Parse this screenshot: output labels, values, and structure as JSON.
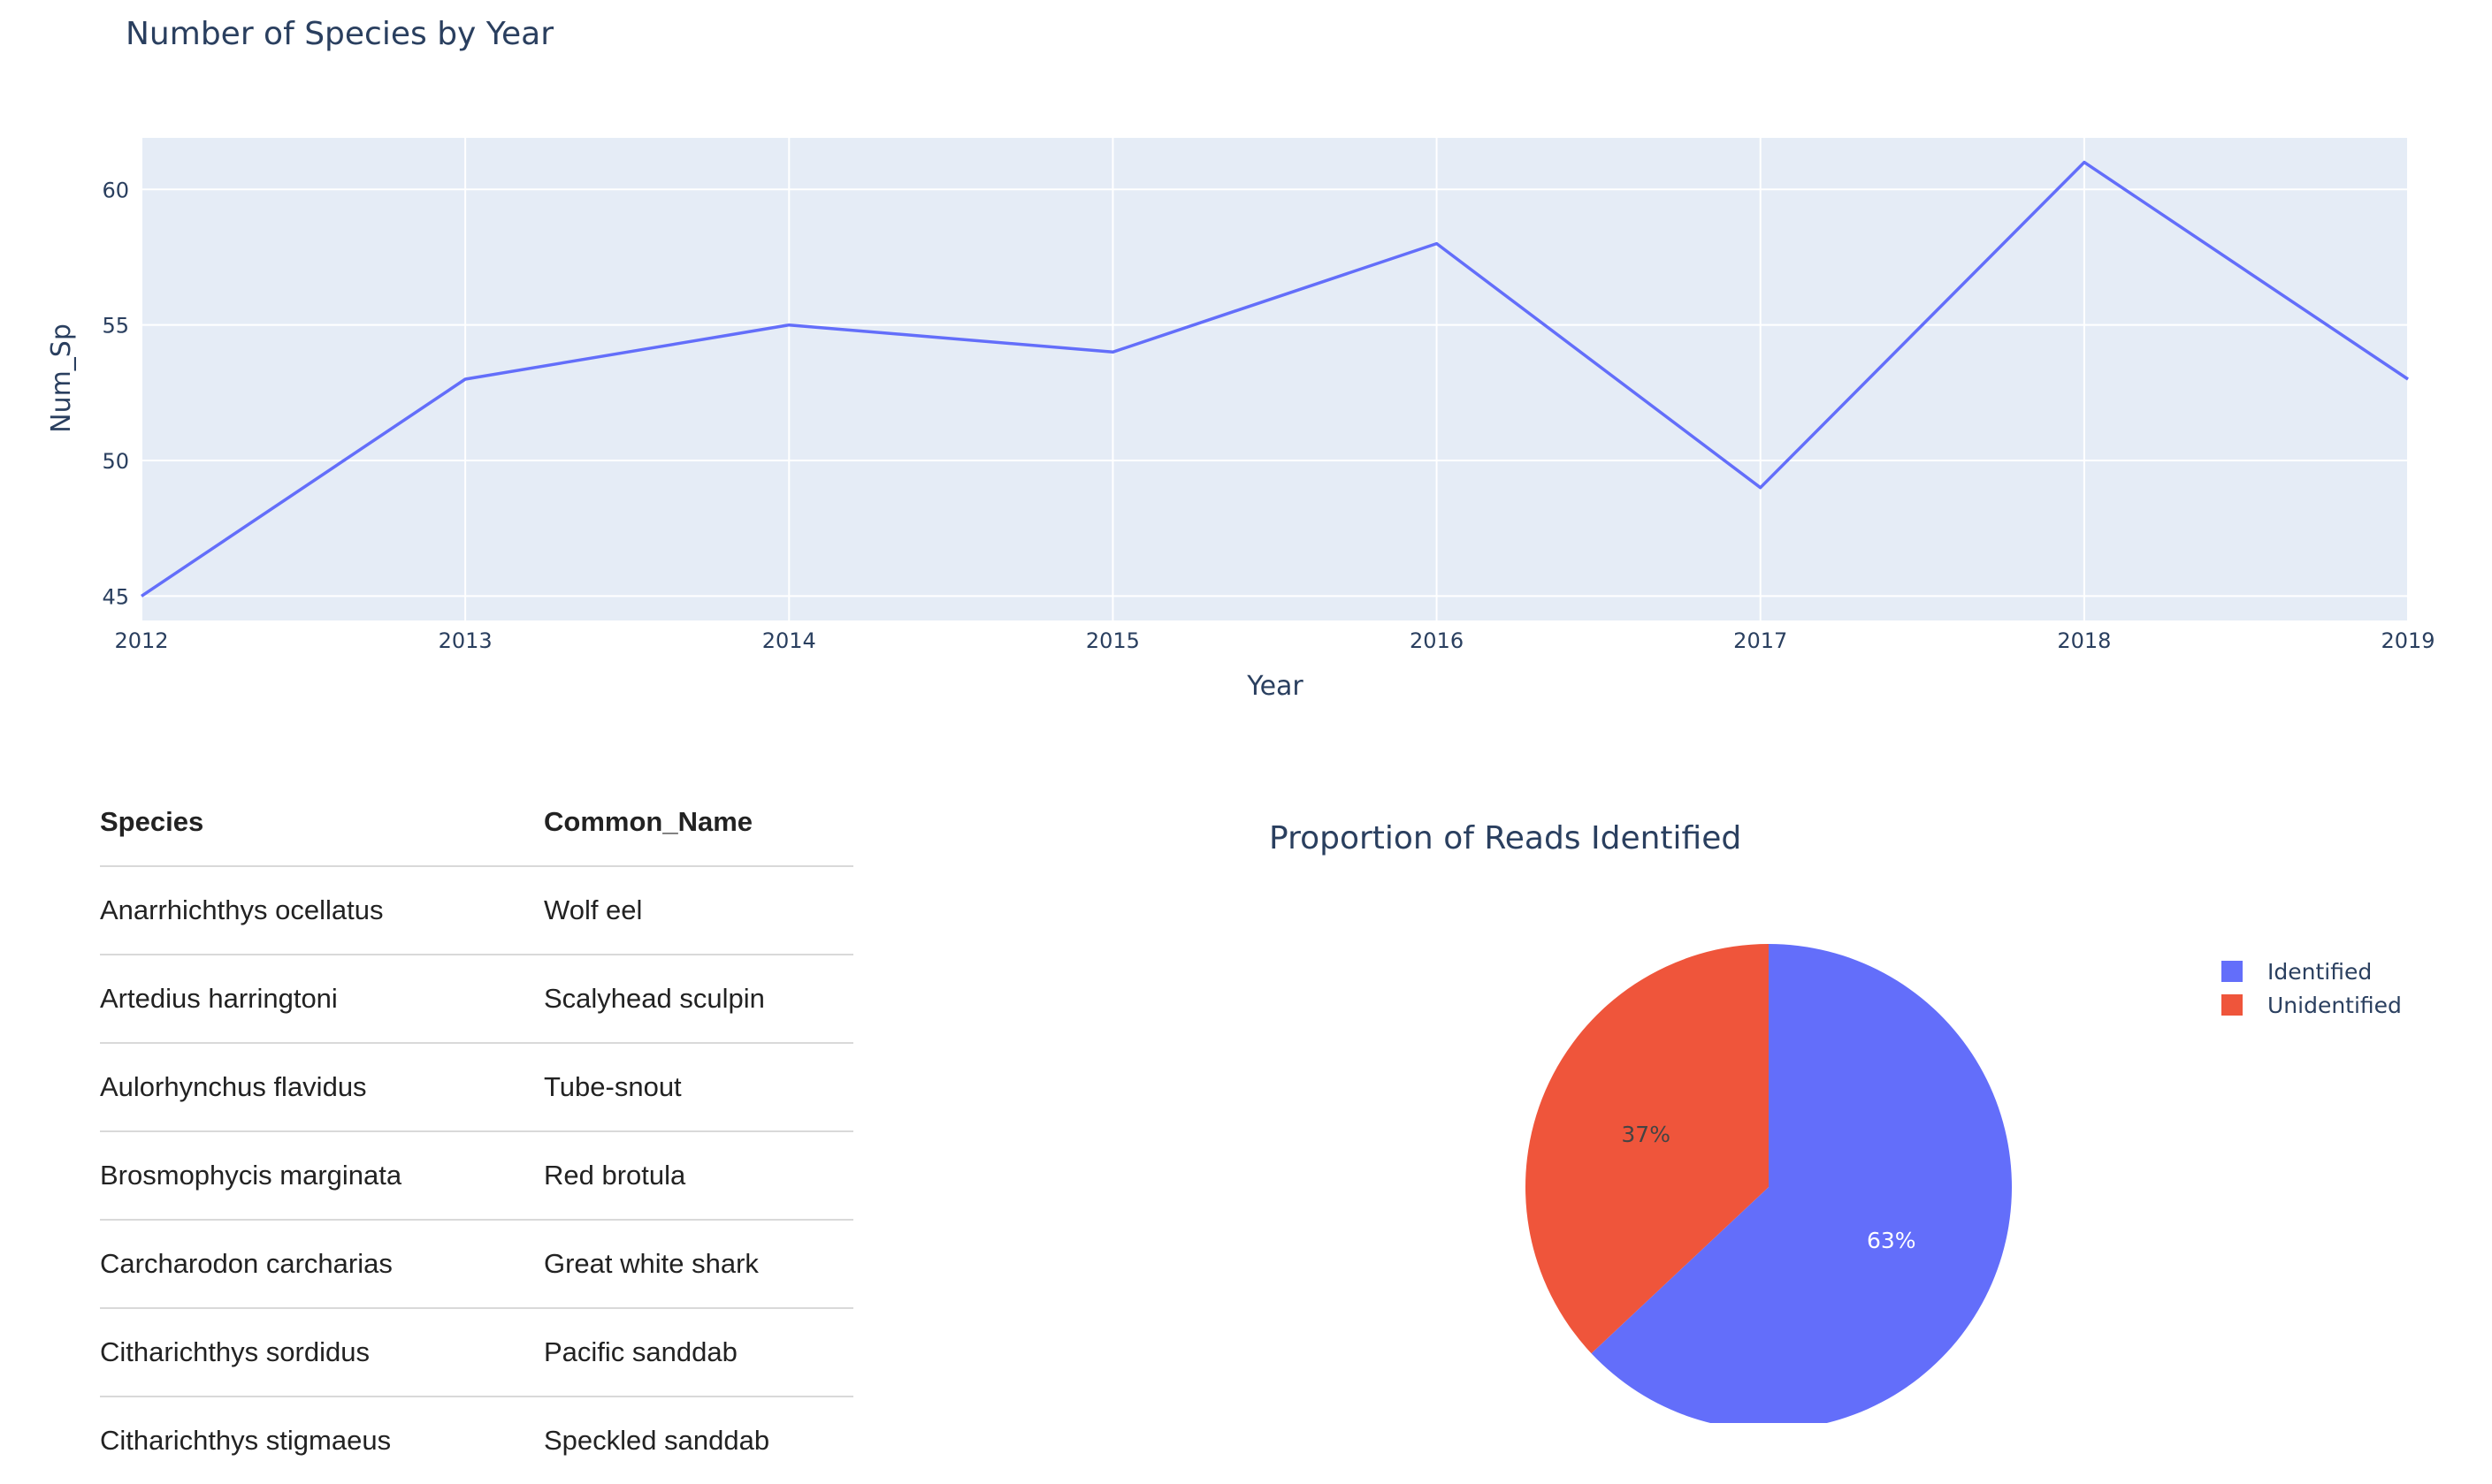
{
  "line_chart": {
    "title": "Number of Species by Year",
    "xlabel": "Year",
    "ylabel": "Num_Sp",
    "line_color": "#636efa",
    "plot_bg": "#e5ecf6"
  },
  "table": {
    "headers": [
      "Species",
      "Common_Name"
    ],
    "rows": [
      [
        "Anarrhichthys ocellatus",
        "Wolf eel"
      ],
      [
        "Artedius harringtoni",
        "Scalyhead sculpin"
      ],
      [
        "Aulorhynchus flavidus",
        "Tube-snout"
      ],
      [
        "Brosmophycis marginata",
        "Red brotula"
      ],
      [
        "Carcharodon carcharias",
        "Great white shark"
      ],
      [
        "Citharichthys sordidus",
        "Pacific sanddab"
      ],
      [
        "Citharichthys stigmaeus",
        "Speckled sanddab"
      ]
    ]
  },
  "pie_chart": {
    "title": "Proportion of Reads Identified",
    "legend": [
      {
        "label": "Identified",
        "color": "#636efa"
      },
      {
        "label": "Unidentified",
        "color": "#ef553b"
      }
    ]
  },
  "chart_data": [
    {
      "type": "line",
      "title": "Number of Species by Year",
      "xlabel": "Year",
      "ylabel": "Num_Sp",
      "x": [
        2012,
        2013,
        2014,
        2015,
        2016,
        2017,
        2018,
        2019
      ],
      "series": [
        {
          "values": [
            45,
            53,
            55,
            54,
            58,
            49,
            61,
            53
          ]
        }
      ],
      "xlim": [
        2012,
        2019
      ],
      "ylim": [
        44.1,
        61.9
      ],
      "yticks": [
        45,
        50,
        55,
        60
      ],
      "grid": true
    },
    {
      "type": "pie",
      "title": "Proportion of Reads Identified",
      "labels": [
        "Identified",
        "Unidentified"
      ],
      "values": [
        63,
        37
      ],
      "text_labels": [
        "63%",
        "37%"
      ],
      "colors": [
        "#636efa",
        "#ef553b"
      ],
      "legend": "top-right"
    },
    {
      "type": "table",
      "columns": [
        "Species",
        "Common_Name"
      ],
      "rows": [
        [
          "Anarrhichthys ocellatus",
          "Wolf eel"
        ],
        [
          "Artedius harringtoni",
          "Scalyhead sculpin"
        ],
        [
          "Aulorhynchus flavidus",
          "Tube-snout"
        ],
        [
          "Brosmophycis marginata",
          "Red brotula"
        ],
        [
          "Carcharodon carcharias",
          "Great white shark"
        ],
        [
          "Citharichthys sordidus",
          "Pacific sanddab"
        ],
        [
          "Citharichthys stigmaeus",
          "Speckled sanddab"
        ]
      ]
    }
  ]
}
